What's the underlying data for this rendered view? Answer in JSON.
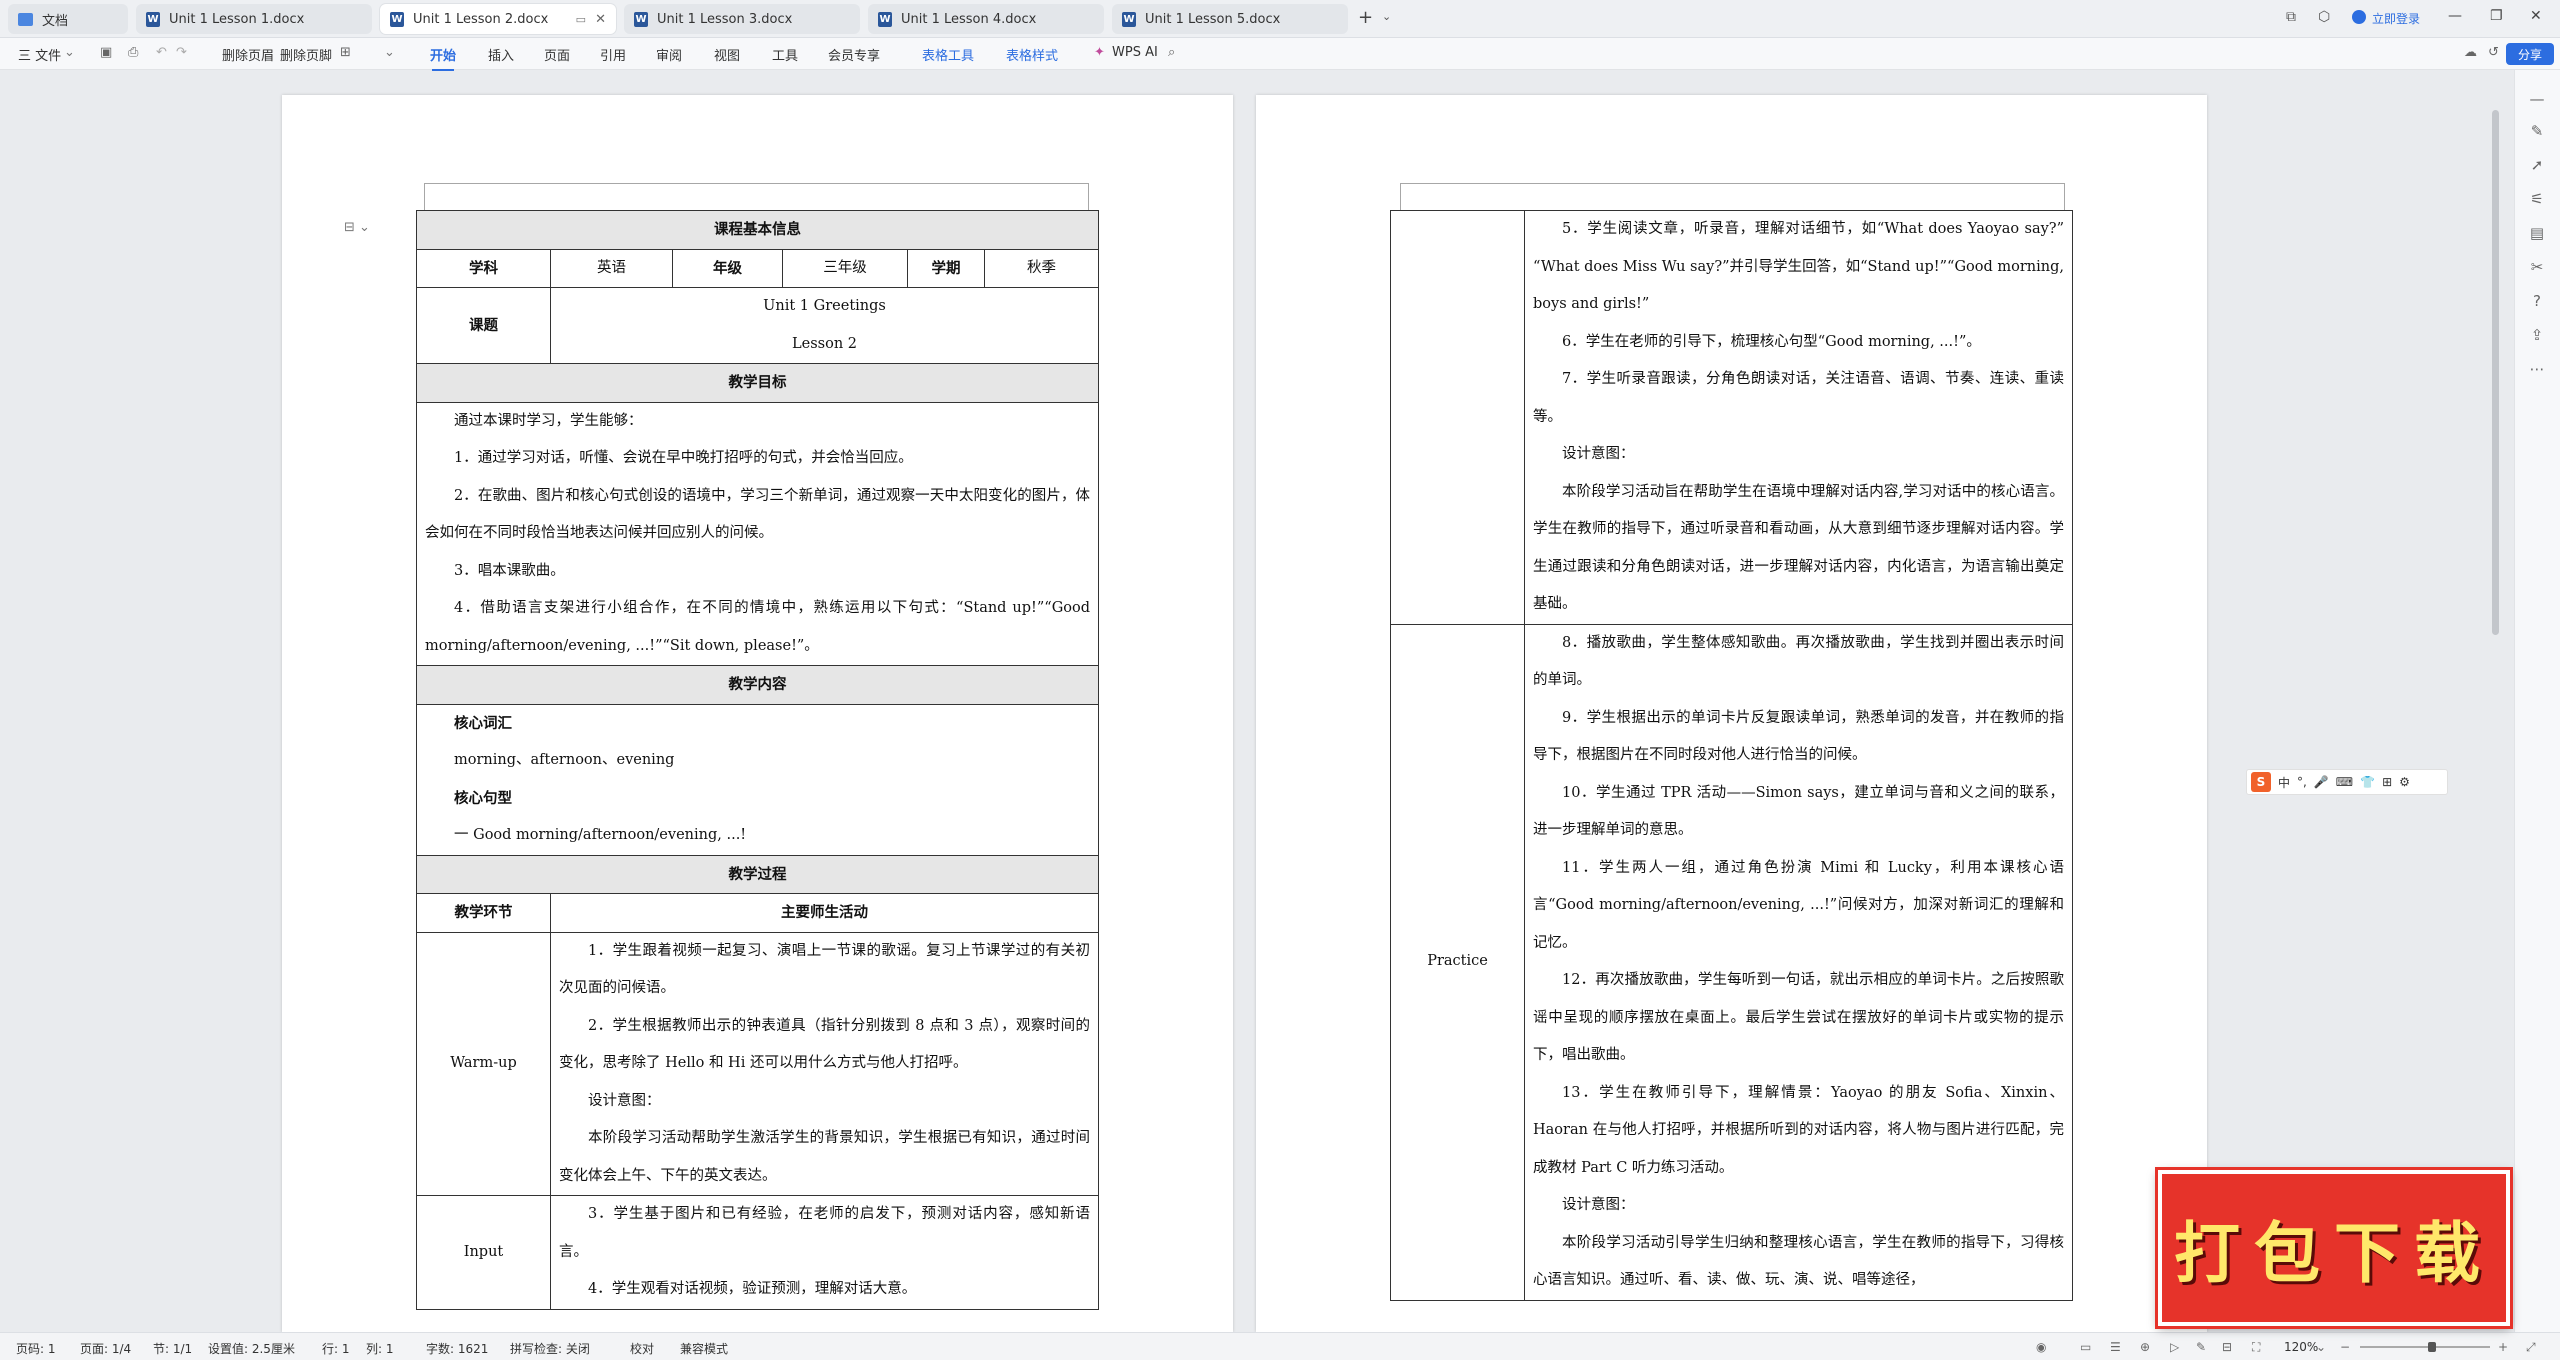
{
  "tabs": [
    {
      "label": "文档",
      "kind": "home"
    },
    {
      "label": "Unit 1 Lesson 1.docx",
      "kind": "doc"
    },
    {
      "label": "Unit 1 Lesson 2.docx",
      "kind": "doc",
      "active": true
    },
    {
      "label": "Unit 1 Lesson 3.docx",
      "kind": "doc"
    },
    {
      "label": "Unit 1 Lesson 4.docx",
      "kind": "doc"
    },
    {
      "label": "Unit 1 Lesson 5.docx",
      "kind": "doc"
    }
  ],
  "titlebar": {
    "login": "立即登录",
    "new_tab": "+"
  },
  "toolbar": {
    "file": "三 文件",
    "delete_header": "删除页眉",
    "delete_footer": "删除页脚",
    "menus": [
      "开始",
      "插入",
      "页面",
      "引用",
      "审阅",
      "视图",
      "工具",
      "会员专享",
      "表格工具",
      "表格样式",
      "WPS AI"
    ],
    "share": "分享"
  },
  "page1": {
    "title": "课程基本信息",
    "info": {
      "subject_label": "学科",
      "subject": "英语",
      "grade_label": "年级",
      "grade": "三年级",
      "term_label": "学期",
      "term": "秋季",
      "topic_label": "课题",
      "topic_line1": "Unit 1 Greetings",
      "topic_line2": "Lesson 2"
    },
    "goals_header": "教学目标",
    "goals": [
      "通过本课时学习，学生能够：",
      "1．通过学习对话，听懂、会说在早中晚打招呼的句式，并会恰当回应。",
      "2．在歌曲、图片和核心句式创设的语境中，学习三个新单词，通过观察一天中太阳变化的图片，体会如何在不同时段恰当地表达问候并回应别人的问候。",
      "3．唱本课歌曲。",
      "4．借助语言支架进行小组合作，在不同的情境中，熟练运用以下句式：“Stand up!”“Good morning/afternoon/evening, ...!”“Sit down, please!”。"
    ],
    "content_header": "教学内容",
    "vocab_title": "核心词汇",
    "vocab": "morning、afternoon、evening",
    "sentence_title": "核心句型",
    "sentence": "一  Good morning/afternoon/evening, ...!",
    "process_header": "教学过程",
    "col_stage": "教学环节",
    "col_activity": "主要师生活动",
    "warmup_label": "Warm-up",
    "warmup": [
      "1．学生跟着视频一起复习、演唱上一节课的歌谣。复习上节课学过的有关初次见面的问候语。",
      "2．学生根据教师出示的钟表道具（指针分别拨到 8 点和 3 点），观察时间的变化，思考除了 Hello 和 Hi 还可以用什么方式与他人打招呼。",
      "设计意图：",
      "本阶段学习活动帮助学生激活学生的背景知识，学生根据已有知识，通过时间变化体会上午、下午的英文表达。"
    ],
    "input_label": "Input",
    "input": [
      "3．学生基于图片和已有经验，在老师的启发下，预测对话内容，感知新语言。",
      "4．学生观看对话视频，验证预测，理解对话大意。"
    ]
  },
  "page2": {
    "input_cont": [
      "5．学生阅读文章，听录音，理解对话细节，如“What does Yaoyao say?” “What does Miss Wu say?”并引导学生回答，如“Stand up!”“Good morning, boys and girls!”",
      "6．学生在老师的引导下，梳理核心句型“Good morning, ...!”。",
      "7．学生听录音跟读，分角色朗读对话，关注语音、语调、节奏、连读、重读等。",
      "设计意图：",
      "本阶段学习活动旨在帮助学生在语境中理解对话内容,学习对话中的核心语言。学生在教师的指导下，通过听录音和看动画，从大意到细节逐步理解对话内容。学生通过跟读和分角色朗读对话，进一步理解对话内容，内化语言，为语言输出奠定基础。"
    ],
    "practice_label": "Practice",
    "practice": [
      "8．播放歌曲，学生整体感知歌曲。再次播放歌曲，学生找到并圈出表示时间的单词。",
      "9．学生根据出示的单词卡片反复跟读单词，熟悉单词的发音，并在教师的指导下，根据图片在不同时段对他人进行恰当的问候。",
      "10．学生通过 TPR 活动——Simon says，建立单词与音和义之间的联系，进一步理解单词的意思。",
      "11．学生两人一组，通过角色扮演 Mimi 和 Lucky，利用本课核心语言“Good morning/afternoon/evening, ...!”问候对方，加深对新词汇的理解和记忆。",
      "12．再次播放歌曲，学生每听到一句话，就出示相应的单词卡片。之后按照歌谣中呈现的顺序摆放在桌面上。最后学生尝试在摆放好的单词卡片或实物的提示下，唱出歌曲。",
      "13．学生在教师引导下，理解情景：Yaoyao 的朋友 Sofia、Xinxin、Haoran 在与他人打招呼，并根据所听到的对话内容，将人物与图片进行匹配，完成教材 Part C 听力练习活动。",
      "设计意图：",
      "本阶段学习活动引导学生归纳和整理核心语言，学生在教师的指导下，习得核心语言知识。通过听、看、读、做、玩、演、说、唱等途径，"
    ]
  },
  "status": {
    "page_no": "页码: 1",
    "pages": "页面: 1/4",
    "section": "节: 1/1",
    "setting": "设置值: 2.5厘米",
    "row": "行: 1",
    "col": "列: 1",
    "words": "字数: 1621",
    "spell": "拼写检查: 关闭",
    "proof": "校对",
    "compat": "兼容模式",
    "zoom": "120%"
  },
  "ime": {
    "label": "中"
  },
  "ad": {
    "text": "打包下载"
  }
}
